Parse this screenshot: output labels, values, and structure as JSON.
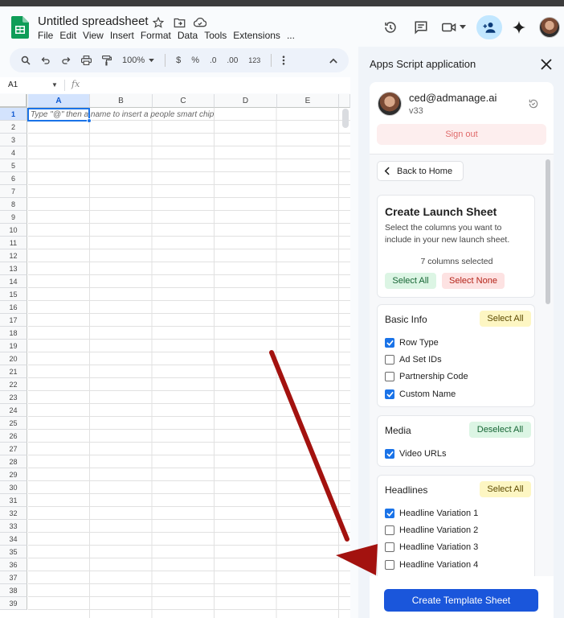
{
  "doc": {
    "title": "Untitled spreadsheet",
    "menus": [
      "File",
      "Edit",
      "View",
      "Insert",
      "Format",
      "Data",
      "Tools",
      "Extensions",
      "..."
    ]
  },
  "toolbar": {
    "zoom": "100%",
    "currency": "$",
    "percent": "%",
    "dec_less": ".0",
    "dec_more": ".00",
    "number_format": "123"
  },
  "formula": {
    "name_box": "A1",
    "fx": "fx"
  },
  "grid": {
    "columns": [
      "A",
      "B",
      "C",
      "D",
      "E"
    ],
    "rows": [
      "1",
      "2",
      "3",
      "4",
      "5",
      "6",
      "7",
      "8",
      "9",
      "10",
      "11",
      "12",
      "13",
      "14",
      "15",
      "16",
      "17",
      "18",
      "19",
      "20",
      "21",
      "22",
      "23",
      "24",
      "25",
      "26",
      "27",
      "28",
      "29",
      "30",
      "31",
      "32",
      "33",
      "34",
      "35",
      "36",
      "37",
      "38",
      "39"
    ],
    "cell_hint": "Type \"@\" then a name to insert a people smart chip"
  },
  "panel": {
    "title": "Apps Script application",
    "user": {
      "email": "ced@admanage.ai",
      "version": "v33"
    },
    "sign_out": "Sign out",
    "back": "Back to Home",
    "launch": {
      "title": "Create Launch Sheet",
      "description": "Select the columns you want to include in your new launch sheet.",
      "count": "7 columns selected",
      "select_all": "Select All",
      "select_none": "Select None"
    },
    "sections": [
      {
        "title": "Basic Info",
        "action": "Select All",
        "items": [
          {
            "label": "Row Type",
            "checked": true
          },
          {
            "label": "Ad Set IDs",
            "checked": false
          },
          {
            "label": "Partnership Code",
            "checked": false
          },
          {
            "label": "Custom Name",
            "checked": true
          }
        ]
      },
      {
        "title": "Media",
        "action": "Deselect All",
        "items": [
          {
            "label": "Video URLs",
            "checked": true
          }
        ]
      },
      {
        "title": "Headlines",
        "action": "Select All",
        "items": [
          {
            "label": "Headline Variation 1",
            "checked": true
          },
          {
            "label": "Headline Variation 2",
            "checked": false
          },
          {
            "label": "Headline Variation 3",
            "checked": false
          },
          {
            "label": "Headline Variation 4",
            "checked": false
          }
        ]
      }
    ],
    "create": "Create Template Sheet"
  },
  "colors": {
    "accent": "#1a73e8",
    "primary_button": "#1a56db",
    "arrow": "#a3120f"
  }
}
